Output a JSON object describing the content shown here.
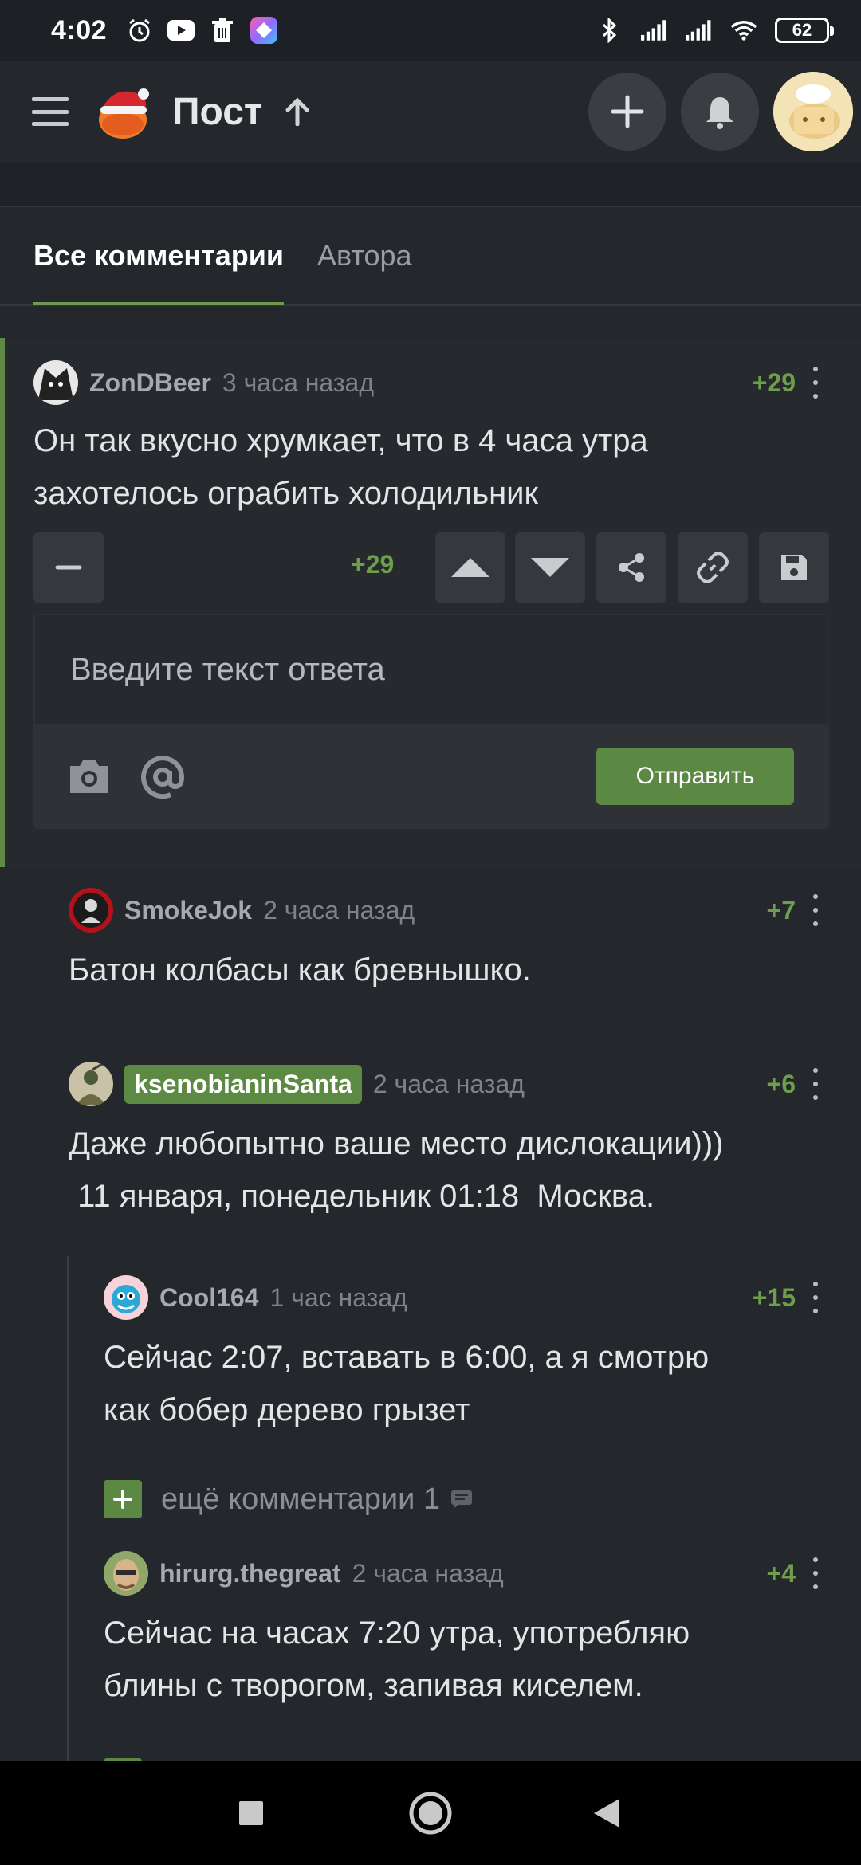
{
  "status_bar": {
    "time": "4:02",
    "battery": "62",
    "icons_left": [
      "alarm-icon",
      "youtube-icon",
      "trash-icon",
      "app-icon"
    ],
    "icons_right": [
      "bluetooth-icon",
      "signal-icon",
      "signal-icon",
      "wifi-icon"
    ]
  },
  "header": {
    "title": "Пост",
    "icons": [
      "menu-icon",
      "logo-santa-icon",
      "arrow-up-icon",
      "plus-icon",
      "bell-icon",
      "avatar"
    ]
  },
  "tabs": [
    {
      "label": "Все комментарии",
      "active": true
    },
    {
      "label": "Автора",
      "active": false
    }
  ],
  "comments": [
    {
      "author": "ZonDBeer",
      "time": "3 часа назад",
      "rating": "+29",
      "text_lines": [
        "Он так вкусно хрумкает, что в 4 часа утра",
        "захотелось ограбить холодильник"
      ]
    },
    {
      "author": "SmokeJok",
      "time": "2 часа назад",
      "rating": "+7",
      "text_lines": [
        "Батон колбасы как бревнышко."
      ]
    },
    {
      "author": "ksenobianinSanta",
      "time": "2 часа назад",
      "rating": "+6",
      "text_lines": [
        "Даже любопытно ваше место дислокации)))",
        " 11 января, понедельник 01:18  Москва."
      ]
    },
    {
      "author": "Cool164",
      "time": "1 час назад",
      "rating": "+15",
      "text_lines": [
        "Сейчас 2:07, вставать в 6:00, а я смотрю",
        "как бобер дерево грызет"
      ]
    },
    {
      "author": "hirurg.thegreat",
      "time": "2 часа назад",
      "rating": "+4",
      "text_lines": [
        "Сейчас на часах 7:20 утра, употребляю",
        "блины с творогом, запивая киселем."
      ]
    }
  ],
  "actions": {
    "rating": "+29",
    "buttons": [
      "minus-icon",
      "upvote-icon",
      "downvote-icon",
      "share-icon",
      "link-icon",
      "save-icon"
    ]
  },
  "reply": {
    "placeholder": "Введите текст ответа",
    "send_label": "Отправить",
    "tools": [
      "camera-icon",
      "mention-icon"
    ]
  },
  "more_comments": {
    "label": "ещё комментарии 1"
  },
  "colors": {
    "accent_green": "#5b8843",
    "rating_green": "#6e9d4c",
    "background": "#24272b"
  }
}
